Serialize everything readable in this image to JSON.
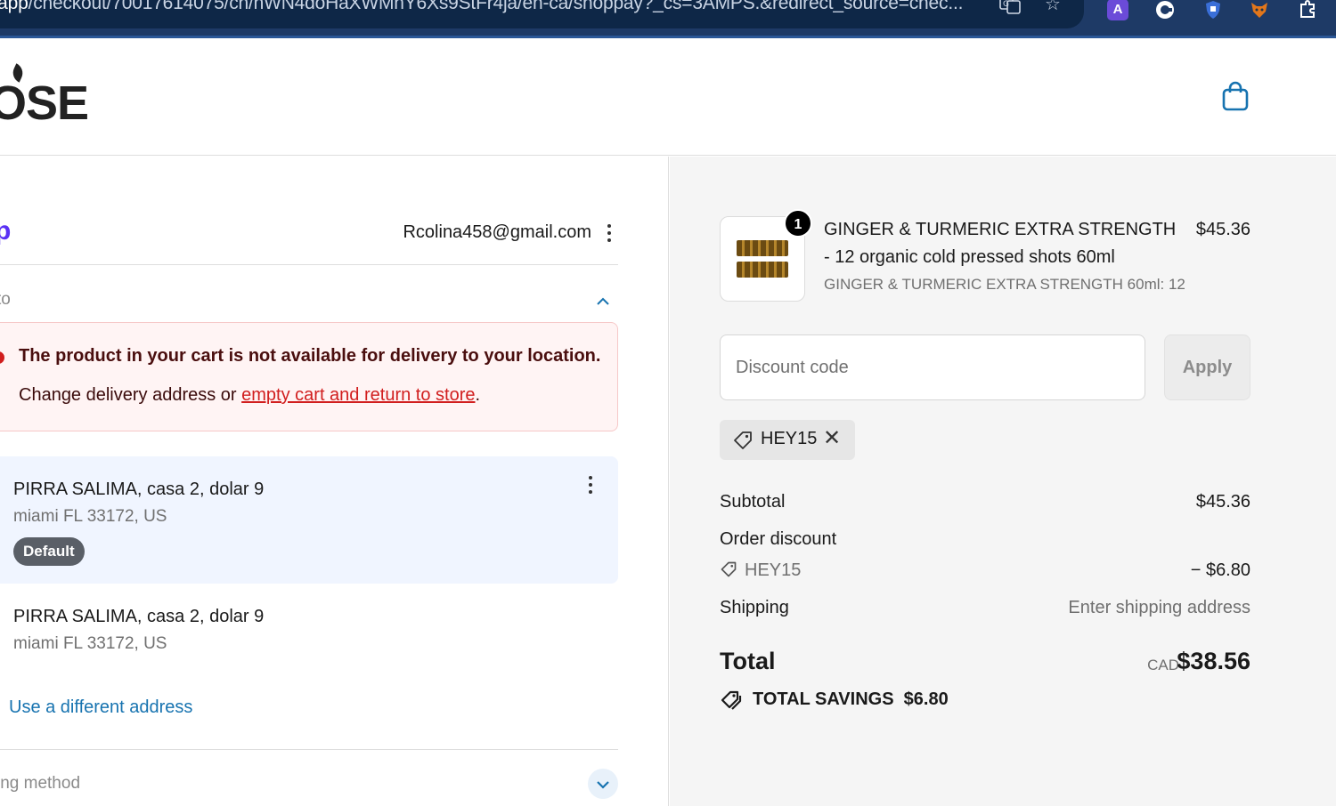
{
  "browser": {
    "url_domain": "p.app",
    "url_path": "/checkout/70017614075/cn/hWN4doHaXWMhY6Xs9StFr4ja/en-ca/shoppay?_cs=3AMPS.&redirect_source=chec...",
    "extensions": [
      "translate-icon",
      "star-icon",
      "ext-a-icon",
      "ext-g-icon",
      "ext-shield-icon",
      "ext-fox-icon",
      "ext-puzzle-icon"
    ]
  },
  "header": {
    "logo_text": "OSE",
    "cart_icon": "shopping-bag-icon"
  },
  "account": {
    "shop_logo": "p",
    "email": "Rcolina458@gmail.com"
  },
  "ship_to": {
    "label": "to"
  },
  "alert": {
    "title": "The product in your cart is not available for delivery to your location.",
    "body_prefix": "Change delivery address or ",
    "link": "empty cart and return to store",
    "body_suffix": "."
  },
  "addresses": [
    {
      "name": "PIRRA SALIMA, casa 2, dolar 9",
      "city": "miami FL 33172, US",
      "badge": "Default"
    },
    {
      "name": "PIRRA SALIMA, casa 2, dolar 9",
      "city": "miami FL 33172, US"
    }
  ],
  "use_different_address": "Use a different address",
  "shipping_method": {
    "label": "ing method"
  },
  "order": {
    "item": {
      "quantity": "1",
      "name": "GINGER & TURMERIC EXTRA STRENGTH - 12 organic cold pressed shots 60ml",
      "variant": "GINGER & TURMERIC EXTRA STRENGTH 60ml: 12",
      "price": "$45.36"
    },
    "discount_placeholder": "Discount code",
    "apply_label": "Apply",
    "applied_code": "HEY15",
    "subtotal_label": "Subtotal",
    "subtotal": "$45.36",
    "order_discount_label": "Order discount",
    "discount_code": "HEY15",
    "discount_amount": "− $6.80",
    "shipping_label": "Shipping",
    "shipping_value": "Enter shipping address",
    "total_label": "Total",
    "currency": "CAD",
    "total": "$38.56",
    "savings_label": "TOTAL SAVINGS",
    "savings": "$6.80"
  },
  "colors": {
    "accent": "#1773b0",
    "alert_bg": "#fff4f4",
    "alert_text": "#d11e1e",
    "shop_purple": "#5a31f4"
  }
}
